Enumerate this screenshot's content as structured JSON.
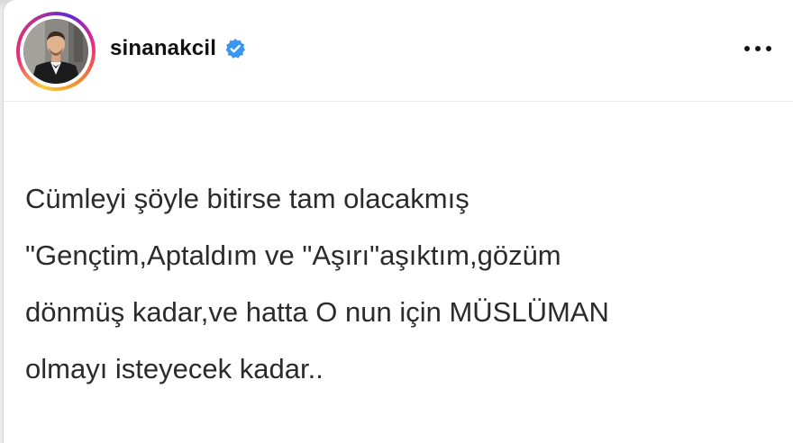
{
  "post": {
    "author": {
      "username": "sinanakcil",
      "verified": true,
      "avatar_icon": "profile-photo"
    },
    "menu_icon": "more-options-icon",
    "text_lines": [
      "Cümleyi şöyle bitirse tam olacakmış",
      "\"Gençtim,Aptaldım ve \"Aşırı\"aşıktım,gözüm",
      "dönmüş kadar,ve hatta O nun için MÜSLÜMAN",
      "olmayı isteyecek kadar.."
    ]
  },
  "colors": {
    "background": "#ffffff",
    "verified_badge": "#3897f0",
    "text": "#2b2b2b",
    "username": "#111111"
  }
}
